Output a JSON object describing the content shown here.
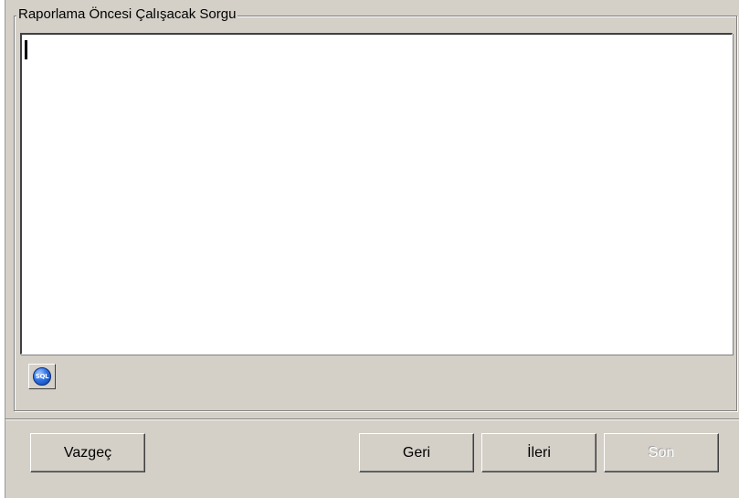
{
  "group": {
    "title": "Raporlama Öncesi Çalışacak Sorgu"
  },
  "editor": {
    "value": ""
  },
  "toolbar": {
    "sql_icon_text": "SQL",
    "sql_icon_name": "sql-icon"
  },
  "buttons": {
    "cancel": "Vazgeç",
    "back": "Geri",
    "next": "İleri",
    "finish": "Son",
    "finish_enabled": false
  }
}
